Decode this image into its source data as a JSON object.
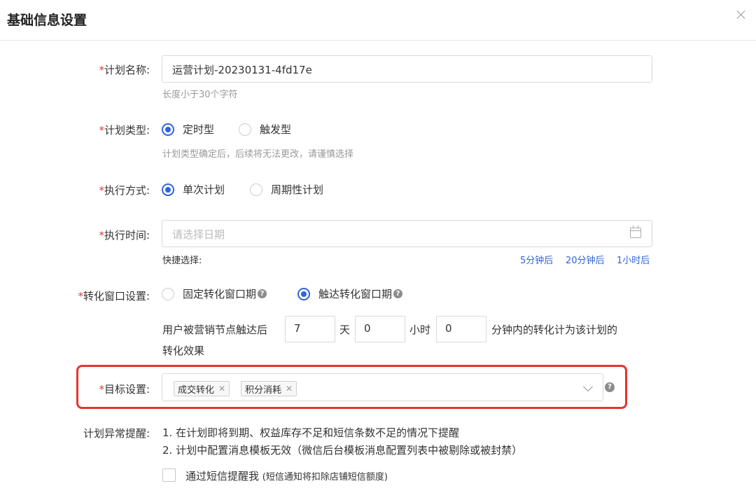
{
  "dialog": {
    "title": "基础信息设置"
  },
  "plan_name": {
    "required": "*",
    "label": "计划名称:",
    "value": "运营计划-20230131-4fd17e",
    "hint": "长度小于30个字符"
  },
  "plan_type": {
    "required": "*",
    "label": "计划类型:",
    "options": [
      "定时型",
      "触发型"
    ],
    "selected": "定时型",
    "hint": "计划类型确定后，后续将无法更改，请谨慎选择"
  },
  "exec_mode": {
    "required": "*",
    "label": "执行方式:",
    "options": [
      "单次计划",
      "周期性计划"
    ],
    "selected": "单次计划"
  },
  "exec_time": {
    "required": "*",
    "label": "执行时间:",
    "placeholder": "请选择日期",
    "quick_label": "快捷选择:",
    "quick_options": [
      "5分钟后",
      "20分钟后",
      "1小时后"
    ]
  },
  "conversion": {
    "required": "*",
    "label": "转化窗口设置:",
    "options": [
      "固定转化窗口期",
      "触达转化窗口期"
    ],
    "selected": "触达转化窗口期",
    "sentence_prefix": "用户被营销节点触达后",
    "days": "7",
    "days_unit": "天",
    "hours": "0",
    "hours_unit": "小时",
    "minutes": "0",
    "sentence_suffix": "分钟内的转化计为该计划的",
    "sentence_line2": "转化效果"
  },
  "target": {
    "required": "*",
    "label": "目标设置:",
    "tags": [
      "成交转化",
      "积分消耗"
    ]
  },
  "alert": {
    "label": "计划异常提醒:",
    "line1": "1. 在计划即将到期、权益库存不足和短信条数不足的情况下提醒",
    "line2": "2. 计划中配置消息模板无效（微信后台模板消息配置列表中被剔除或被封禁）",
    "sms_label": "通过短信提醒我",
    "sms_note": "(短信通知将扣除店铺短信额度)"
  },
  "colors": {
    "accent": "#2f64d9",
    "required": "#e53935",
    "highlight": "#e5352f"
  }
}
